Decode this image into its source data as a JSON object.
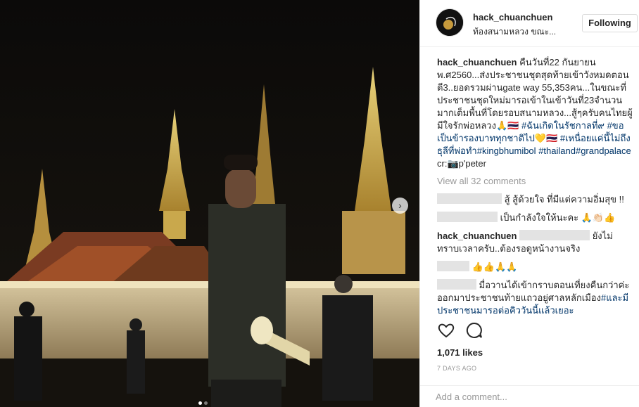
{
  "post": {
    "username": "hack_chuanchuen",
    "location": "ท้องสนามหลวง ขณะ...",
    "follow_label": "Following"
  },
  "caption": {
    "username": "hack_chuanchuen",
    "text": "คืนวันที่22 กันยายน พ.ศ2560...ส่งประชาชนชุดสุดท้ายเข้าวังหมดตอนตี3..ยอดรวมผ่านgate way 55,353คน...ในขณะที่ประชาชนชุดใหม่มารอเข้าในเข้าวันที่23จำนวนมากเต็มพื้นที่โดยรอบสนามหลวง...สู้ๆครับคนไทยผู้มีใจรักพ่อหลวง🙏🇹🇭",
    "tags": [
      "#ฉันเกิดในรัชกาลที่๙",
      "#ขอเป็นข้ารองบาททุกชาติไป",
      "#เหนื่อยแค่นี้ไม่ถึงธุลีที่พ่อทำ",
      "#kingbhumibol",
      "#thailand",
      "#grandpalace"
    ],
    "heart_emoji": "💛🇹🇭",
    "credit": "cr:📷p'peter"
  },
  "view_all_comments": "View all 32 comments",
  "comments": [
    {
      "text": "สู้ สู้ด้วยใจ ที่มีแต่ความอิ่มสุข !!"
    },
    {
      "text": "เป็นกำลังใจให้นะคะ 🙏👏🏻👍"
    },
    {
      "username": "hack_chuanchuen",
      "text": "ยังไม่ทราบเวลาครับ..ต้องรอดูหน้างานจริง"
    },
    {
      "text": "👍👍🙏🙏"
    },
    {
      "text": "มื่อวานได้เข้ากราบตอนเที่ยงคืนกว่าค่ะออกมาประชาชนท้ายแถวอยู่ศาลหลักเมือง",
      "tag": "#และมีประชาชนมารอต่อคิววันนี้แล้วเยอะ"
    }
  ],
  "likes": "1,071 likes",
  "date": "7 DAYS AGO",
  "add_comment_placeholder": "Add a comment...",
  "icons": {
    "like": "heart-icon",
    "comment": "comment-icon",
    "next": "chevron-right-icon"
  }
}
